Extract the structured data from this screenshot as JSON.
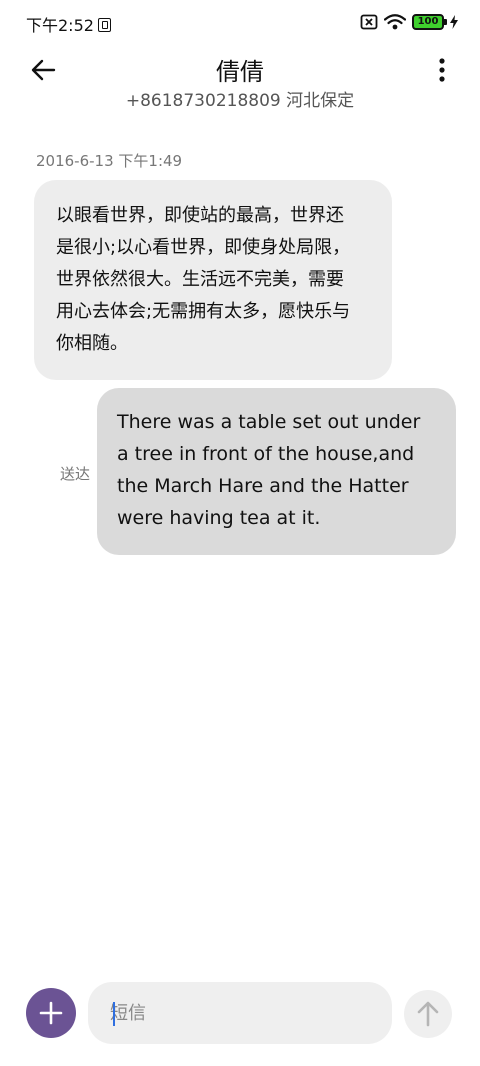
{
  "status_bar": {
    "time": "下午2:52",
    "battery": "100"
  },
  "header": {
    "title": "倩倩",
    "subtitle": "+8618730218809 河北保定"
  },
  "conversation": {
    "timestamp": "2016-6-13 下午1:49",
    "incoming_message": "以眼看世界，即使站的最高，世界还是很小;以心看世界，即使身处局限，世界依然很大。生活远不完美，需要用心去体会;无需拥有太多，愿快乐与你相随。",
    "outgoing_status": "送达",
    "outgoing_message": "There was a table set out under a tree in front of the house,and the March Hare and the Hatter were having tea at it."
  },
  "composer": {
    "placeholder": "短信"
  },
  "colors": {
    "accent": "#6b5394",
    "incoming_bubble": "#ededed",
    "outgoing_bubble": "#dadada",
    "battery": "#3fcf2d"
  },
  "icons": {
    "back": "arrow-left-icon",
    "menu": "more-vertical-icon",
    "add": "plus-icon",
    "send": "arrow-up-icon"
  }
}
